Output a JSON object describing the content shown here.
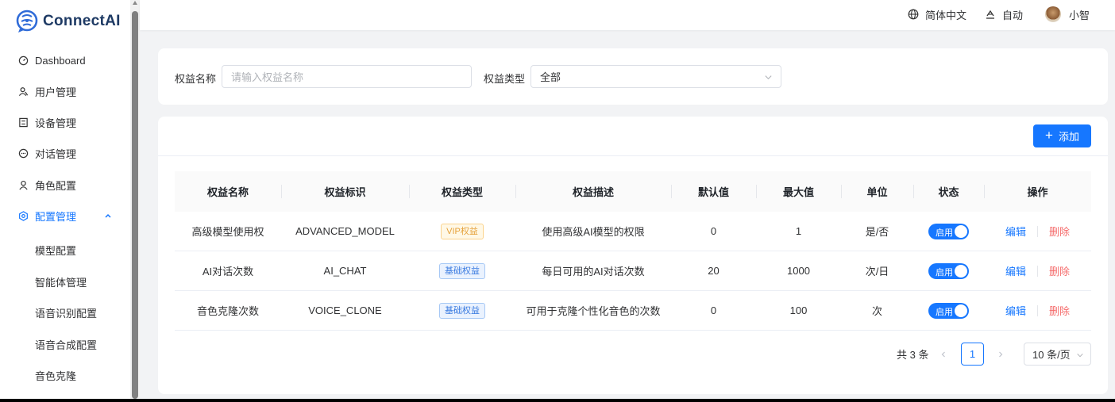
{
  "brand": {
    "name": "ConnectAI"
  },
  "sidebar": {
    "items": [
      {
        "label": "Dashboard",
        "icon": "dashboard-icon"
      },
      {
        "label": "用户管理",
        "icon": "user-manage-icon"
      },
      {
        "label": "设备管理",
        "icon": "device-icon"
      },
      {
        "label": "对话管理",
        "icon": "chat-icon"
      },
      {
        "label": "角色配置",
        "icon": "role-icon"
      },
      {
        "label": "配置管理",
        "icon": "settings-icon",
        "active": true,
        "expanded": true
      }
    ],
    "sub_items": [
      "模型配置",
      "智能体管理",
      "语音识别配置",
      "语音合成配置",
      "音色克隆"
    ]
  },
  "topbar": {
    "language": "简体中文",
    "theme": "自动",
    "user": "小智"
  },
  "filters": {
    "name_label": "权益名称",
    "name_placeholder": "请输入权益名称",
    "type_label": "权益类型",
    "type_value": "全部"
  },
  "toolbar": {
    "add_label": "添加"
  },
  "table": {
    "columns": [
      "权益名称",
      "权益标识",
      "权益类型",
      "权益描述",
      "默认值",
      "最大值",
      "单位",
      "状态",
      "操作"
    ],
    "rows": [
      {
        "name": "高级模型使用权",
        "key": "ADVANCED_MODEL",
        "type": "VIP权益",
        "type_style": "vip",
        "desc": "使用高级AI模型的权限",
        "default": "0",
        "max": "1",
        "unit": "是/否",
        "status": "启用"
      },
      {
        "name": "AI对话次数",
        "key": "AI_CHAT",
        "type": "基础权益",
        "type_style": "base",
        "desc": "每日可用的AI对话次数",
        "default": "20",
        "max": "1000",
        "unit": "次/日",
        "status": "启用"
      },
      {
        "name": "音色克隆次数",
        "key": "VOICE_CLONE",
        "type": "基础权益",
        "type_style": "base",
        "desc": "可用于克隆个性化音色的次数",
        "default": "0",
        "max": "100",
        "unit": "次",
        "status": "启用"
      }
    ],
    "actions": {
      "edit": "编辑",
      "delete": "删除"
    }
  },
  "pagination": {
    "total_text": "共 3 条",
    "current_page": "1",
    "page_size": "10 条/页"
  },
  "colors": {
    "accent": "#1677ff",
    "danger": "#f56c6c",
    "vip": "#e6a23c"
  }
}
